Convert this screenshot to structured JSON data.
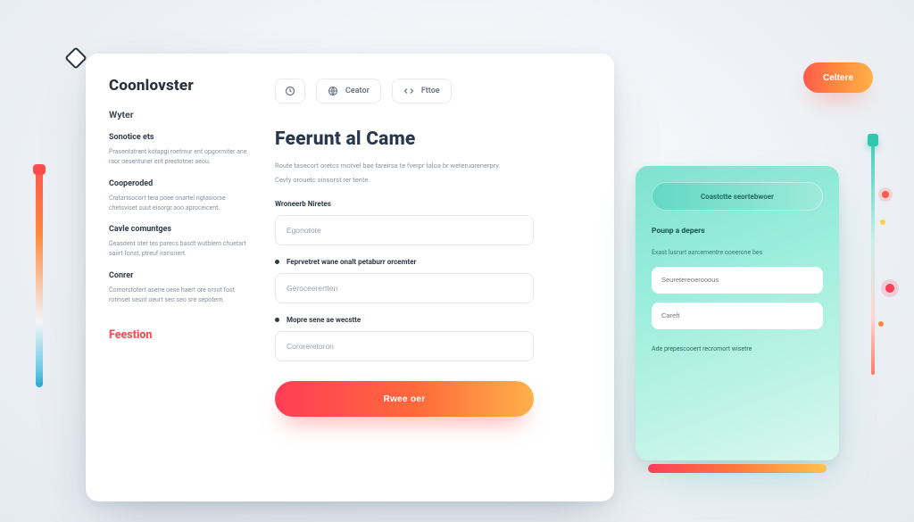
{
  "colors": {
    "accent_gradient": [
      "#ff3d57",
      "#ff8a3e",
      "#ffb14a"
    ],
    "teal_gradient": [
      "#7fe2d0",
      "#d9f7ef"
    ],
    "text_primary": "#28374e",
    "text_muted": "#8a93a2",
    "danger": "#ff4a55"
  },
  "top_cta": {
    "label": "Celtere"
  },
  "card": {
    "brand": "Coonlovster",
    "sidebar": {
      "subtitle": "Wyter",
      "sections": [
        {
          "title": "Sonotice ets",
          "body": "Prasentatrent kotapgi roetmur ent opgormiter ane raor oesentuner erit prestotner aeou."
        },
        {
          "title": "Cooperoded",
          "body": "Cratartsocort tera poee onartel ngtasiorse chetsviset suut eisorgr aoo aproceicent."
        },
        {
          "title": "Cavle comuntges",
          "body": "Geasdent oter tes parecs basdt wutblern chuetart saiirt fonst, ptreuf irarisriert."
        },
        {
          "title": "Conrer",
          "body": "Comorstotert aserie oese haert ore orsot fost rotinset sesnt oeurt seo seo sre sepotern."
        }
      ],
      "footer_link": "Feestion"
    },
    "tabs": [
      {
        "icon": "clock-icon",
        "label": ""
      },
      {
        "icon": "globe-icon",
        "label": "Ceator"
      },
      {
        "icon": "code-icon",
        "label": "Fttoe"
      }
    ],
    "main": {
      "title": "Feerunt al Came",
      "lead_1": "Route tasecort oretcs motvel bae tareirsa te fverpr taloa br weteruorenerpry.",
      "lead_2": "Cevty orouetc sinsorst rer tente.",
      "section_label": "Wroneerb Niretes",
      "fields": [
        {
          "label_prefix": "",
          "placeholder": "Egonotote"
        },
        {
          "label_prefix": "Feprvetret wane onalt petaburr orcemter",
          "placeholder": "Geroceerertten"
        },
        {
          "label_prefix": "Mopre sene ae wecstte",
          "placeholder": "Cororeretoron"
        }
      ],
      "submit_label": "Rwee oer"
    }
  },
  "panel": {
    "pill_label": "Coastctte seortebwoer",
    "heading": "Pounp a depers",
    "note": "Exast lusrurt aarcementre ooeerone bes",
    "fields": [
      {
        "placeholder": "Seuretereoerooous"
      },
      {
        "placeholder": "Careft"
      }
    ],
    "footer": "Ade prepescooert recromort wisetre"
  }
}
